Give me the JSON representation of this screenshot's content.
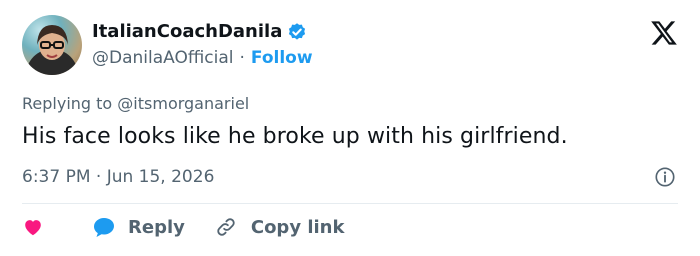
{
  "author": {
    "display_name": "ItalianCoachDanila",
    "handle": "@DanilaAOfficial",
    "separator": "·",
    "follow_label": "Follow",
    "verified": true
  },
  "reply": {
    "prefix": "Replying to ",
    "handle": "@itsmorganariel"
  },
  "tweet": {
    "text": "His face looks like he broke up with his girlfriend."
  },
  "meta": {
    "timestamp": "6:37 PM · Jun 15, 2026"
  },
  "actions": {
    "reply_label": "Reply",
    "copy_link_label": "Copy link"
  },
  "colors": {
    "accent": "#1d9bf0",
    "heart": "#f91880",
    "text": "#0f1419",
    "muted": "#536471"
  },
  "icons": [
    "avatar",
    "verified-badge-icon",
    "x-logo-icon",
    "info-icon",
    "heart-icon",
    "reply-bubble-icon",
    "link-icon"
  ]
}
